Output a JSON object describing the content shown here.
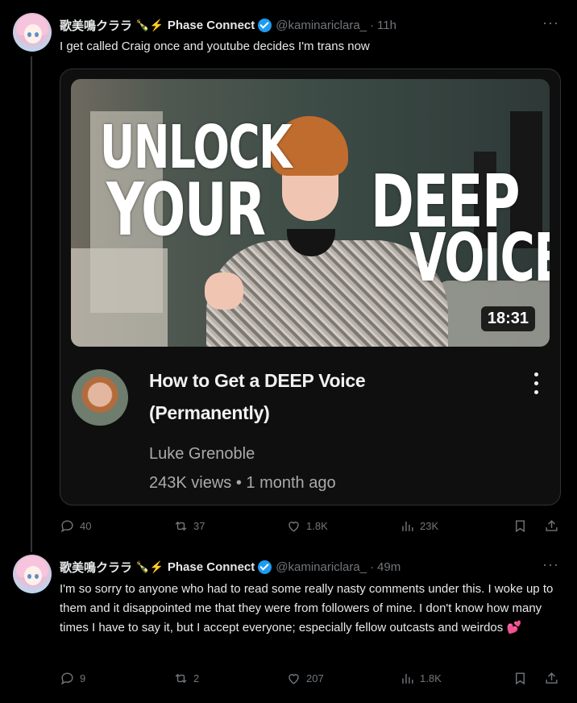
{
  "tweets": [
    {
      "name": "歌美鳴クララ",
      "emoji": "🍾⚡",
      "affiliation": "Phase Connect",
      "handle": "@kaminariclara_",
      "time": "11h",
      "more_icon": "···",
      "text": "I get called Craig once and youtube decides I'm trans now",
      "card": {
        "thumbnail_text": [
          "UNLOCK",
          "YOUR",
          "DEEP",
          "VOICE"
        ],
        "duration": "18:31",
        "title_line1": "How to Get a DEEP Voice",
        "title_line2": "(Permanently)",
        "channel": "Luke Grenoble",
        "meta": "243K views • 1 month ago"
      },
      "actions": {
        "replies": "40",
        "reposts": "37",
        "likes": "1.8K",
        "views": "23K"
      }
    },
    {
      "name": "歌美鳴クララ",
      "emoji": "🍾⚡",
      "affiliation": "Phase Connect",
      "handle": "@kaminariclara_",
      "time": "49m",
      "more_icon": "···",
      "text": "I'm so sorry to anyone who had to read some really nasty comments under this. I woke up to them and it disappointed me that they were from followers of mine. I don't know how many times I have to say it, but I accept everyone; especially fellow outcasts and weirdos",
      "text_emoji": "💕",
      "actions": {
        "replies": "9",
        "reposts": "2",
        "likes": "207",
        "views": "1.8K"
      }
    }
  ],
  "colors": {
    "background": "#000000",
    "text": "#e7e9ea",
    "muted": "#71767b",
    "verified": "#1d9bf0",
    "border": "#2f3336"
  },
  "icons": [
    "reply-icon",
    "repost-icon",
    "like-icon",
    "views-icon",
    "bookmark-icon",
    "share-icon",
    "more-icon",
    "verified-badge-icon",
    "kebab-menu-icon"
  ]
}
